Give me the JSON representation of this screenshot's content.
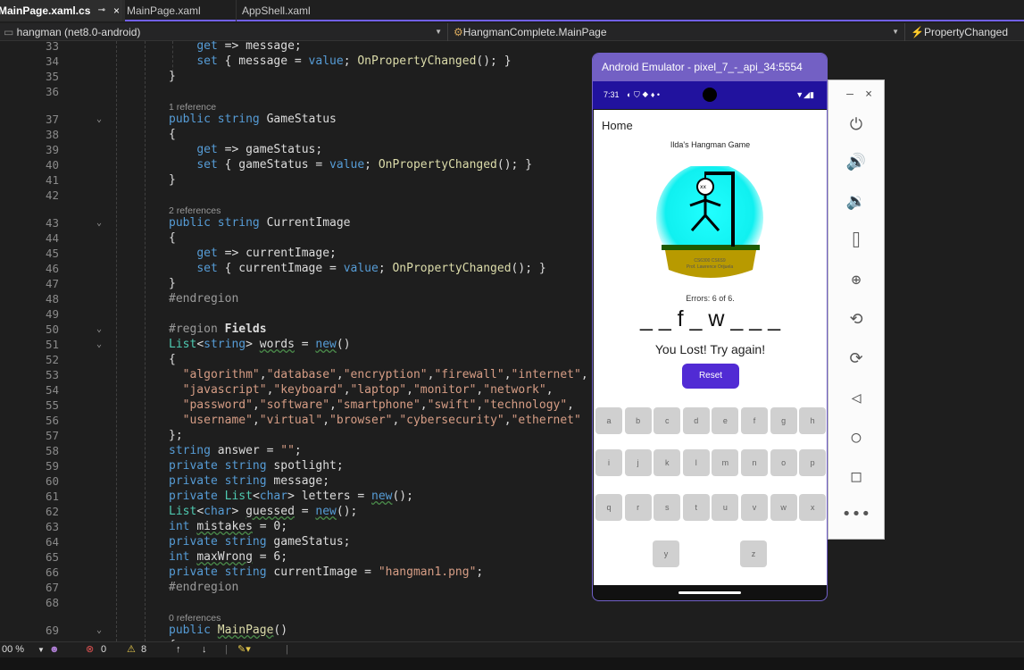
{
  "tabs": [
    {
      "label": "MainPage.xaml.cs",
      "close": "×",
      "pin": "⊸"
    },
    {
      "label": "MainPage.xaml"
    },
    {
      "label": "AppShell.xaml"
    }
  ],
  "nav": {
    "project": "hangman (net8.0-android)",
    "class": "HangmanComplete.MainPage",
    "member": "PropertyChanged"
  },
  "statusbar": {
    "zoom": "00 %",
    "errors": "0",
    "warnings": "8"
  },
  "emulator": {
    "title": "Android Emulator - pixel_7_-_api_34:5554",
    "time": "7:31",
    "app_title": "Home",
    "game_title": "Ilda's Hangman Game",
    "image_caption_1": "CS6300 CS6S9",
    "image_caption_2": "Prof. Lawrence Orijuela",
    "errors": "Errors: 6 of 6.",
    "spotlight": "_ _ f _ w _ _ _",
    "message": "You Lost! Try again!",
    "reset": "Reset",
    "keys_row1": [
      "a",
      "b",
      "c",
      "d",
      "e",
      "f",
      "g",
      "h"
    ],
    "keys_row2": [
      "i",
      "j",
      "k",
      "l",
      "m",
      "n",
      "o",
      "p"
    ],
    "keys_row3": [
      "q",
      "r",
      "s",
      "t",
      "u",
      "v",
      "w",
      "x"
    ],
    "keys_row4": [
      "y",
      "z"
    ]
  },
  "code_lines": [
    {
      "n": "33",
      "html": "    <span class='ctx'>get</span> => message;"
    },
    {
      "n": "34",
      "html": "    <span class='ctx'>set</span> { message = <span class='kw'>value</span>; <span class='mt'>OnPropertyChanged</span>(); }"
    },
    {
      "n": "35",
      "html": "}"
    },
    {
      "n": "36",
      "html": ""
    },
    {
      "n": "37",
      "html": "<span class='kw'>public</span> <span class='kw'>string</span> GameStatus",
      "lens": "1 reference",
      "fold": "⌄"
    },
    {
      "n": "38",
      "html": "{"
    },
    {
      "n": "39",
      "html": "    <span class='ctx'>get</span> => gameStatus;"
    },
    {
      "n": "40",
      "html": "    <span class='ctx'>set</span> { gameStatus = <span class='kw'>value</span>; <span class='mt'>OnPropertyChanged</span>(); }"
    },
    {
      "n": "41",
      "html": "}"
    },
    {
      "n": "42",
      "html": ""
    },
    {
      "n": "43",
      "html": "<span class='kw'>public</span> <span class='kw'>string</span> CurrentImage",
      "lens": "2 references",
      "fold": "⌄"
    },
    {
      "n": "44",
      "html": "{"
    },
    {
      "n": "45",
      "html": "    <span class='ctx'>get</span> => currentImage;"
    },
    {
      "n": "46",
      "html": "    <span class='ctx'>set</span> { currentImage = <span class='kw'>value</span>; <span class='mt'>OnPropertyChanged</span>(); }"
    },
    {
      "n": "47",
      "html": "}"
    },
    {
      "n": "48",
      "html": "<span class='pp'>#endregion</span>"
    },
    {
      "n": "49",
      "html": ""
    },
    {
      "n": "50",
      "html": "<span class='pp'>#region</span> <b>Fields</b>",
      "fold": "⌄"
    },
    {
      "n": "51",
      "html": "<span class='ty'>List</span>&lt;<span class='kw'>string</span>&gt; <span class='sq'>words</span> = <span class='kw sq'>new</span>()",
      "fold": "⌄"
    },
    {
      "n": "52",
      "html": "{"
    },
    {
      "n": "53",
      "html": "  <span class='st'>\"algorithm\"</span>,<span class='st'>\"database\"</span>,<span class='st'>\"encryption\"</span>,<span class='st'>\"firewall\"</span>,<span class='st'>\"internet\"</span>,"
    },
    {
      "n": "54",
      "html": "  <span class='st'>\"javascript\"</span>,<span class='st'>\"keyboard\"</span>,<span class='st'>\"laptop\"</span>,<span class='st'>\"monitor\"</span>,<span class='st'>\"network\"</span>,"
    },
    {
      "n": "55",
      "html": "  <span class='st'>\"password\"</span>,<span class='st'>\"software\"</span>,<span class='st'>\"smartphone\"</span>,<span class='st'>\"swift\"</span>,<span class='st'>\"technology\"</span>,"
    },
    {
      "n": "56",
      "html": "  <span class='st'>\"username\"</span>,<span class='st'>\"virtual\"</span>,<span class='st'>\"browser\"</span>,<span class='st'>\"cybersecurity\"</span>,<span class='st'>\"ethernet\"</span>"
    },
    {
      "n": "57",
      "html": "};"
    },
    {
      "n": "58",
      "html": "<span class='kw'>string</span> answer = <span class='st'>\"\"</span>;"
    },
    {
      "n": "59",
      "html": "<span class='kw'>private</span> <span class='kw'>string</span> spotlight;"
    },
    {
      "n": "60",
      "html": "<span class='kw'>private</span> <span class='kw'>string</span> message;"
    },
    {
      "n": "61",
      "html": "<span class='kw'>private</span> <span class='ty'>List</span>&lt;<span class='kw'>char</span>&gt; letters = <span class='kw sq'>new</span>();"
    },
    {
      "n": "62",
      "html": "<span class='ty'>List</span>&lt;<span class='kw'>char</span>&gt; <span class='sq'>guessed</span> = <span class='kw sq'>new</span>();"
    },
    {
      "n": "63",
      "html": "<span class='kw'>int</span> <span class='sq'>mistakes</span> = 0;"
    },
    {
      "n": "64",
      "html": "<span class='kw'>private</span> <span class='kw'>string</span> gameStatus;"
    },
    {
      "n": "65",
      "html": "<span class='kw'>int</span> <span class='sq'>maxWrong</span> = 6;"
    },
    {
      "n": "66",
      "html": "<span class='kw'>private</span> <span class='kw'>string</span> currentImage = <span class='st'>\"hangman1.png\"</span>;"
    },
    {
      "n": "67",
      "html": "<span class='pp'>#endregion</span>"
    },
    {
      "n": "68",
      "html": ""
    },
    {
      "n": "69",
      "html": "<span class='kw'>public</span> <span class='mt sq'>MainPage</span>()",
      "lens": "0 references",
      "fold": "⌄"
    }
  ]
}
